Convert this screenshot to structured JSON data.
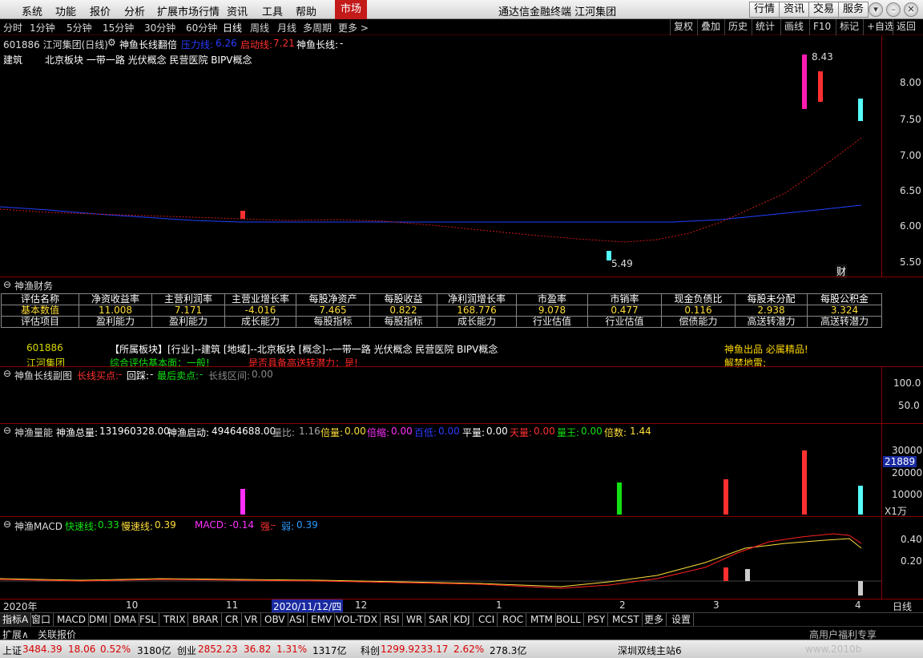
{
  "menu": {
    "items": [
      "系统",
      "功能",
      "报价",
      "分析",
      "扩展市场行情",
      "资讯",
      "工具",
      "帮助"
    ],
    "market_tab": "市场",
    "window_title": "通达信金融终端 江河集团",
    "right_buttons": [
      "行情",
      "资讯",
      "交易",
      "服务"
    ]
  },
  "toolbar": {
    "periods": [
      "分时",
      "1分钟",
      "5分钟",
      "15分钟",
      "30分钟",
      "60分钟",
      "日线",
      "周线",
      "月线",
      "多周期",
      "更多 >"
    ],
    "active_period": "日线",
    "right_buttons": [
      "复权",
      "叠加",
      "历史",
      "统计",
      "画线",
      "F10",
      "标记",
      "+自选",
      "返回"
    ]
  },
  "main_chart": {
    "code_title": "601886 江河集团(日线)",
    "indicator_name": "神鱼长线翻倍",
    "pressure_label": "压力线:",
    "pressure_value": "6.26",
    "start_label": "启动线:",
    "start_value": "7.21",
    "longline_label": "神鱼长线:",
    "longline_value": "-",
    "industry": "建筑",
    "concepts": "北京板块 一带一路 光伏概念 民营医院 BIPV概念",
    "y_ticks": [
      "8.00",
      "7.50",
      "7.00",
      "6.50",
      "6.00",
      "5.50"
    ],
    "high_mark": "8.43",
    "low_mark": "5.49",
    "fin_badge": "财",
    "colors": {
      "up": "#ff3030",
      "down": "#54ffff",
      "ma_red": "#ff3030",
      "ma_blue": "#2040ff"
    }
  },
  "finance": {
    "panel_title": "神渔财务",
    "headers": [
      "评估名称",
      "净资收益率",
      "主营利润率",
      "主营业增长率",
      "每股净资产",
      "每股收益",
      "净利润增长率",
      "市盈率",
      "市销率",
      "现金负债比",
      "每股未分配",
      "每股公积金"
    ],
    "values": [
      "基本数值",
      "11.008",
      "7.171",
      "-4.016",
      "7.465",
      "0.822",
      "168.776",
      "9.078",
      "0.477",
      "0.116",
      "2.938",
      "3.324"
    ],
    "categories": [
      "评估项目",
      "盈利能力",
      "盈利能力",
      "成长能力",
      "每股指标",
      "每股指标",
      "成长能力",
      "行业估值",
      "行业估值",
      "偿债能力",
      "高送转潜力",
      "高送转潜力"
    ],
    "code": "601886",
    "name": "江河集团",
    "sector_text": "【所属板块】[行业]--建筑 [地域]--北京板块 [概念]--一带一路 光伏概念 民营医院 BIPV概念",
    "eval_text": "综合评估基本面：一般!",
    "high_send_text": "是否具备高送转潜力：是!",
    "quality_text": "神鱼出品 必属精品!",
    "unlock_text": "解禁地雷:"
  },
  "longline_panel": {
    "title": "神鱼长线副图",
    "buy_label": "长线买点:",
    "buy_value": "-",
    "hold_label": "回踩:",
    "hold_value": "-",
    "sell_label": "最后卖点:",
    "sell_value": "-",
    "range_label": "长线区间:",
    "range_value": "0.00",
    "y_ticks": [
      "100.0",
      "50.0"
    ]
  },
  "volume_panel": {
    "title": "神渔量能",
    "total_label": "神渔总量:",
    "total_value": "131960328.00",
    "start_label": "神渔启动:",
    "start_value": "49464688.00",
    "ratio_label": "量比:",
    "ratio_value": "1.16",
    "double_label": "倍量:",
    "double_value": "0.00",
    "shrink_label": "倍缩:",
    "shrink_value": "0.00",
    "hundred_label": "百低:",
    "hundred_value": "0.00",
    "flat_label": "平量:",
    "flat_value": "0.00",
    "sky_label": "天量:",
    "sky_value": "0.00",
    "king_label": "量王:",
    "king_value": "0.00",
    "times_label": "倍数:",
    "times_value": "1.44",
    "y_ticks": [
      "30000",
      "20000",
      "10000"
    ],
    "current_badge": "21889",
    "unit": "X1万"
  },
  "macd_panel": {
    "title": "神渔MACD",
    "fast_label": "快速线:",
    "fast_value": "0.33",
    "slow_label": "慢速线:",
    "slow_value": "0.39",
    "macd_label": "MACD:",
    "macd_value": "-0.14",
    "strong_label": "强:",
    "strong_value": "-",
    "weak_label": "弱:",
    "weak_value": "0.39",
    "y_ticks": [
      "0.40",
      "0.20"
    ]
  },
  "time_axis": {
    "labels": [
      "2020年",
      "10",
      "11",
      "2020/11/12/四",
      "12",
      "1",
      "2",
      "3",
      "4"
    ],
    "right_label": "日线"
  },
  "indicator_tabs": [
    "指标A",
    "窗口",
    "MACD",
    "DMI",
    "DMA",
    "FSL",
    "TRIX",
    "BRAR",
    "CR",
    "VR",
    "OBV",
    "ASI",
    "EMV",
    "VOL-TDX",
    "RSI",
    "WR",
    "SAR",
    "KDJ",
    "CCI",
    "ROC",
    "MTM",
    "BOLL",
    "PSY",
    "MCST",
    "更多",
    "设置"
  ],
  "link_bar": {
    "items": [
      "扩展∧",
      "关联报价"
    ],
    "right_text": "高用户福利专享"
  },
  "status_bar": {
    "sh_label": "上证",
    "sh_price": "3484.39",
    "sh_change": "18.06",
    "sh_pct": "0.52%",
    "sh_amount": "3180亿",
    "cy_label": "创业",
    "cy_price": "2852.23",
    "cy_change": "36.82",
    "cy_pct": "1.31%",
    "cy_amount": "1317亿",
    "kc_label": "科创",
    "kc_price": "1299.92",
    "kc_change": "33.17",
    "kc_pct": "2.62%",
    "kc_amount": "278.3亿",
    "station": "深圳双线主站6",
    "watermark_site": "www.2010b"
  }
}
